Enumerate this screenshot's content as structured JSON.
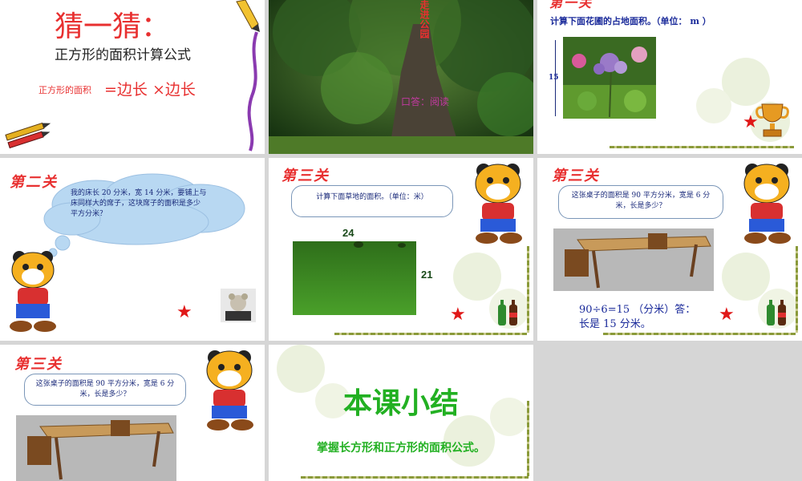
{
  "slide1": {
    "title": "猜一猜：",
    "subtitle": "正方形的面积计算公式",
    "formula_label": "正方形的面积",
    "formula_expr": "=边长 ×边长"
  },
  "slide2": {
    "title_vertical": "走进公园",
    "caption": "口答：阅读"
  },
  "slide3": {
    "level": "第一关",
    "question": "计算下面花圃的占地面积。（单位： m ）",
    "dimension": "15"
  },
  "slide4": {
    "level": "第二关",
    "question": "我的床长 20 分米，宽 14 分米，要铺上与床同样大的席子，这块席子的面积是多少平方分米？"
  },
  "slide5": {
    "level": "第三关",
    "question": "计算下面草地的面积。（单位：米）",
    "width": "24",
    "height": "21"
  },
  "slide6": {
    "level": "第三关",
    "question": "这张桌子的面积是 90 平方分米，宽是 6 分米，长是多少？",
    "answer_line1": "90÷6=15 （分米）答：",
    "answer_line2": "长是 15 分米。"
  },
  "slide7": {
    "level": "第三关",
    "question": "这张桌子的面积是 90 平方分米，宽是 6 分米，长是多少？"
  },
  "slide8": {
    "title": "本课小结",
    "summary": "掌握长方形和正方形的面积公式。"
  },
  "colors": {
    "red": "#e83030",
    "green": "#22b022",
    "navy": "#1a2a7a"
  }
}
